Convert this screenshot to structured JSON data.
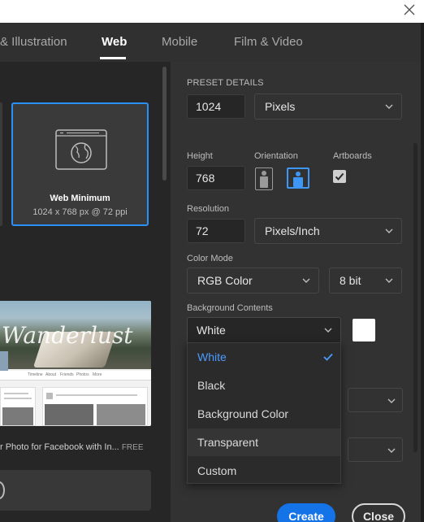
{
  "window": {
    "close_icon": "close-icon"
  },
  "tabs": [
    {
      "label": "& Illustration"
    },
    {
      "label": "Web"
    },
    {
      "label": "Mobile"
    },
    {
      "label": "Film & Video"
    }
  ],
  "active_tab": "Web",
  "preset_card": {
    "icon": "web-globe-icon",
    "title": "Web Minimum",
    "subtitle": "1024 x 768 px @ 72 ppi"
  },
  "template": {
    "thumbnail_text": "Wanderlust",
    "nav_tabs": [
      "Timeline",
      "About",
      "Friends",
      "Photos",
      "More"
    ],
    "caption": "r Photo for Facebook with In...",
    "badge": "FREE"
  },
  "details": {
    "section_title": "PRESET DETAILS",
    "width_value": "1024",
    "width_unit": "Pixels",
    "height_label": "Height",
    "height_value": "768",
    "orientation_label": "Orientation",
    "artboards_label": "Artboards",
    "resolution_label": "Resolution",
    "resolution_value": "72",
    "resolution_unit": "Pixels/Inch",
    "color_mode_label": "Color Mode",
    "color_mode_value": "RGB Color",
    "bit_depth_value": "8 bit",
    "bg_contents_label": "Background Contents",
    "bg_contents_value": "White",
    "bg_swatch_color": "#ffffff"
  },
  "dropdown": {
    "options": [
      "White",
      "Black",
      "Background Color",
      "Transparent",
      "Custom"
    ],
    "selected": "White"
  },
  "buttons": {
    "create": "Create",
    "close": "Close"
  },
  "colors": {
    "accent": "#1473e6",
    "selection": "#2a8ff7"
  }
}
